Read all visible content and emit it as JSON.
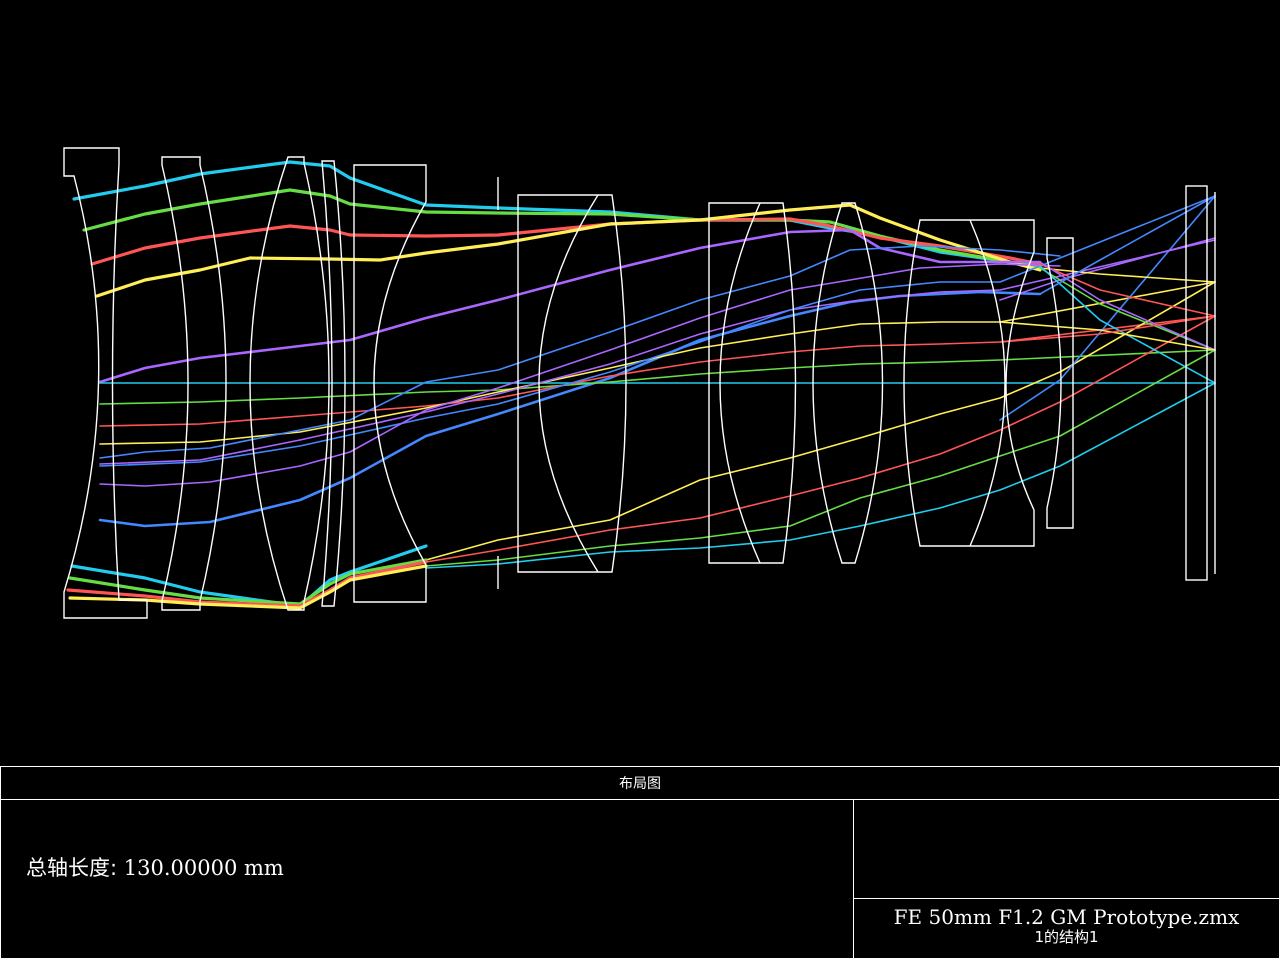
{
  "diagram": {
    "elements": [
      "lens-1",
      "lens-2",
      "lens-3",
      "lens-4",
      "lens-5",
      "aperture-stop",
      "lens-6",
      "lens-7",
      "lens-8",
      "lens-9",
      "lens-10",
      "filter-plate",
      "image-plane"
    ],
    "ray_colors": [
      "#22ccee",
      "#66dd44",
      "#ff5555",
      "#ffee55",
      "#aa66ff",
      "#4488ff"
    ]
  },
  "footer": {
    "title": "布局图",
    "axis_label": "总轴长度:",
    "axis_value": "130.00000 mm",
    "file_name": "FE 50mm F1.2 GM Prototype.zmx",
    "config": "1的结构1"
  }
}
